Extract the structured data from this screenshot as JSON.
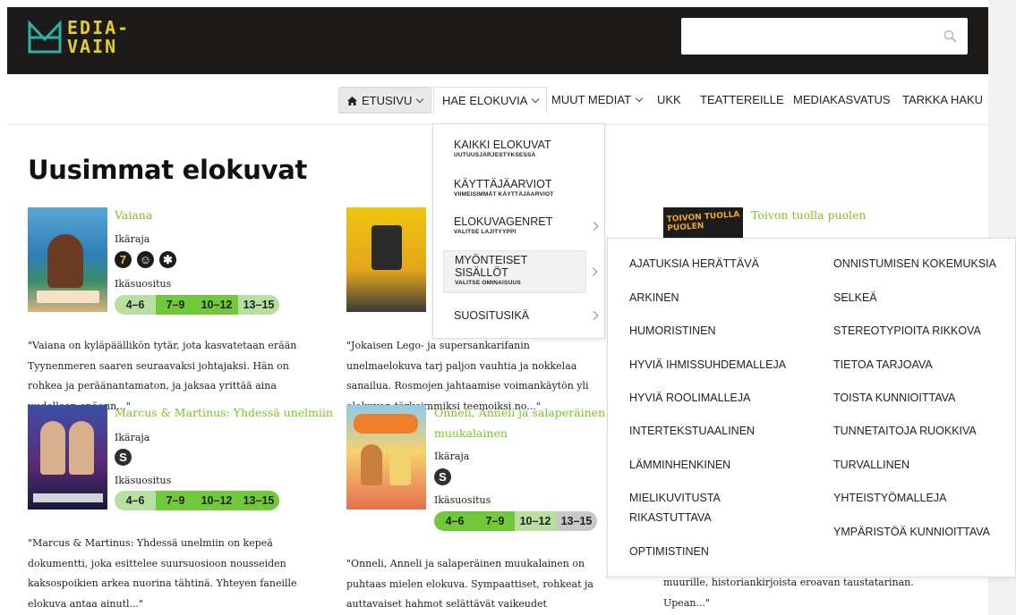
{
  "brand": {
    "logo_line1": "EDIA-",
    "logo_line2": "VAIN",
    "accent": "#e3cf27",
    "logo_color": "#28b3a7"
  },
  "search": {
    "placeholder": "",
    "icon": "search-icon"
  },
  "nav": {
    "home": "ETUSIVU",
    "films": "HAE ELOKUVIA",
    "other_media": "MUUT MEDIAT",
    "faq": "UKK",
    "theaters": "TEATTEREILLE",
    "media_education": "MEDIAKASVATUS",
    "advanced_search": "TARKKA HAKU"
  },
  "page_title": "Uusimmat elokuvat",
  "labels": {
    "age_limit": "Ikäraja",
    "age_recommendation": "Ikäsuositus"
  },
  "rec_groups": [
    "4–6",
    "7–9",
    "10–12",
    "13–15"
  ],
  "movies": [
    {
      "title": "Vaiana",
      "age_limit": "7",
      "description": "\"Vaiana on kyläpäällikön tytär, jota kasvatetaan erään Tyynenmeren saaren seuraavaksi johtajaksi. Hän on rohkea ja peräänantamaton, ja jaksaa yrittää aina uudelleen epäonn...\""
    },
    {
      "title": "Marcus & Martinus: Yhdessä unelmiin",
      "age_limit": "S",
      "description": "\"Marcus & Martinus: Yhdessä unelmiin on kepeä dokumentti, joka esittelee suursuosioon nousseiden kaksospoikien arkea nuorina tähtinä. Yhteyen faneille elokuva antaa ainutl...\""
    },
    {
      "title": "Onneli, Anneli ja salaperäinen muukalainen",
      "age_limit": "S",
      "description": "\"Onneli, Anneli ja salaperäinen muukalainen on puhtaas mielen elokuva. Sympaattiset, rohkeat ja auttavaiset hahmot selättävät vaikeudet kekseliäisyydellä ja yhteis...\""
    },
    {
      "title": "Toivon tuolla puolen",
      "poster_text": "TOIVON TUOLLA PUOLEN",
      "description": "muurille, historiankirjoista eroavan taustatarinan. Upean...\""
    },
    {
      "description": "\"Jokaisen Lego- ja supersankarifanin unelmaelokuva tarj paljon vauhtia ja nokkelaa sanailua. Rosmojen jahtaamise voimankäytön yli elokuvan tärkeimmiksi teemoiksi no...\""
    }
  ],
  "dropdown": [
    {
      "title": "KAIKKI ELOKUVAT",
      "sub": "UUTUUSJÄRJESTYKSESSÄ"
    },
    {
      "title": "KÄYTTÄJÄARVIOT",
      "sub": "VIIMEISIMMÄT KÄYTTÄJÄARVIOT"
    },
    {
      "title": "ELOKUVAGENRET",
      "sub": "VALITSE LAJITYYPPI"
    },
    {
      "title": "MYÖNTEISET SISÄLLÖT",
      "sub": "VALITSE OMINAISUUS"
    },
    {
      "title": "SUOSITUSIKÄ",
      "sub": ""
    }
  ],
  "qualities_left": [
    "AJATUKSIA HERÄTTÄVÄ",
    "ARKINEN",
    "HUMORISTINEN",
    "HYVIÄ IHMISSUHDEMALLEJA",
    "HYVIÄ ROOLIMALLEJA",
    "INTERTEKSTUAALINEN",
    "LÄMMINHENKINEN",
    "MIELIKUVITUSTA RIKASTUTTAVA",
    "OPTIMISTINEN"
  ],
  "qualities_right": [
    "ONNISTUMISEN KOKEMUKSIA",
    "SELKEÄ",
    "STEREOTYPIOITA RIKKOVA",
    "TIETOA TARJOAVA",
    "TOISTA KUNNIOITTAVA",
    "TUNNETAITOJA RUOKKIVA",
    "TURVALLINEN",
    "YHTEISTYÖMALLEJA",
    "YMPÄRISTÖÄ KUNNIOITTAVA"
  ]
}
